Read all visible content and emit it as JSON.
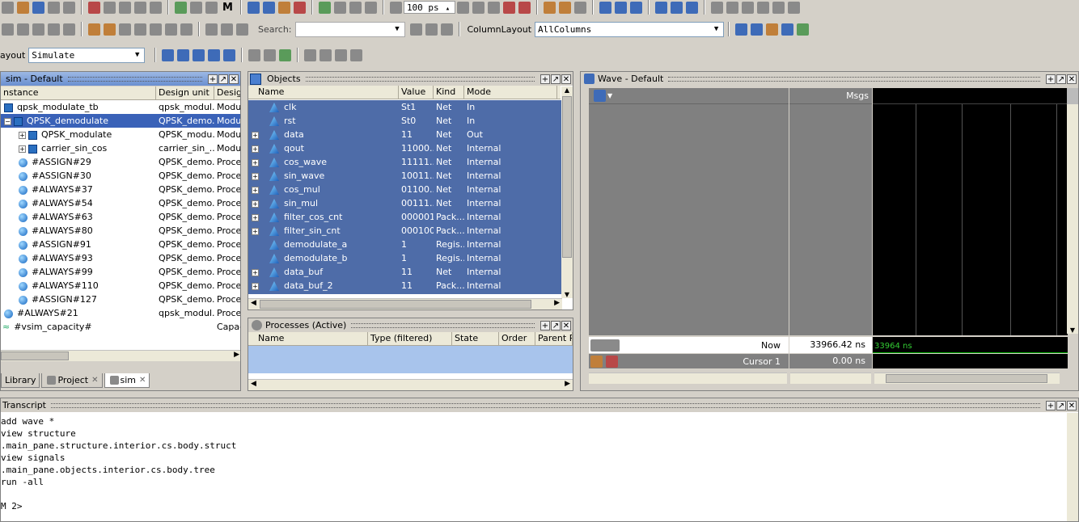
{
  "toolbar1": {
    "zoom_value": "100 ps",
    "m_label": "M"
  },
  "toolbar2": {
    "search_label": "Search:",
    "search_value": "",
    "column_layout_label": "ColumnLayout",
    "column_layout_value": "AllColumns"
  },
  "toolbar3": {
    "layout_label": "ayout",
    "layout_value": "Simulate"
  },
  "sim_panel": {
    "title": "sim - Default",
    "columns": [
      "nstance",
      "Design unit",
      "Design"
    ],
    "rows": [
      {
        "name": "qpsk_modulate_tb",
        "unit": "qpsk_modul...",
        "type": "Module",
        "icon": "module",
        "indent": 0,
        "expander": ""
      },
      {
        "name": "QPSK_demodulate",
        "unit": "QPSK_demo...",
        "type": "Module",
        "icon": "module",
        "indent": 0,
        "expander": "-",
        "selected": true
      },
      {
        "name": "QPSK_modulate",
        "unit": "QPSK_modu...",
        "type": "Module",
        "icon": "module",
        "indent": 1,
        "expander": "+"
      },
      {
        "name": "carrier_sin_cos",
        "unit": "carrier_sin_...",
        "type": "Module",
        "icon": "module",
        "indent": 1,
        "expander": "+"
      },
      {
        "name": "#ASSIGN#29",
        "unit": "QPSK_demo...",
        "type": "Proces",
        "icon": "process",
        "indent": 1,
        "expander": ""
      },
      {
        "name": "#ASSIGN#30",
        "unit": "QPSK_demo...",
        "type": "Proces",
        "icon": "process",
        "indent": 1,
        "expander": ""
      },
      {
        "name": "#ALWAYS#37",
        "unit": "QPSK_demo...",
        "type": "Proces",
        "icon": "process",
        "indent": 1,
        "expander": ""
      },
      {
        "name": "#ALWAYS#54",
        "unit": "QPSK_demo...",
        "type": "Proces",
        "icon": "process",
        "indent": 1,
        "expander": ""
      },
      {
        "name": "#ALWAYS#63",
        "unit": "QPSK_demo...",
        "type": "Proces",
        "icon": "process",
        "indent": 1,
        "expander": ""
      },
      {
        "name": "#ALWAYS#80",
        "unit": "QPSK_demo...",
        "type": "Proces",
        "icon": "process",
        "indent": 1,
        "expander": ""
      },
      {
        "name": "#ASSIGN#91",
        "unit": "QPSK_demo...",
        "type": "Proces",
        "icon": "process",
        "indent": 1,
        "expander": ""
      },
      {
        "name": "#ALWAYS#93",
        "unit": "QPSK_demo...",
        "type": "Proces",
        "icon": "process",
        "indent": 1,
        "expander": ""
      },
      {
        "name": "#ALWAYS#99",
        "unit": "QPSK_demo...",
        "type": "Proces",
        "icon": "process",
        "indent": 1,
        "expander": ""
      },
      {
        "name": "#ALWAYS#110",
        "unit": "QPSK_demo...",
        "type": "Proces",
        "icon": "process",
        "indent": 1,
        "expander": ""
      },
      {
        "name": "#ASSIGN#127",
        "unit": "QPSK_demo...",
        "type": "Proces",
        "icon": "process",
        "indent": 1,
        "expander": ""
      },
      {
        "name": "#ALWAYS#21",
        "unit": "qpsk_modul...",
        "type": "Proces",
        "icon": "process",
        "indent": 0,
        "expander": ""
      },
      {
        "name": "#vsim_capacity#",
        "unit": "",
        "type": "Capac",
        "icon": "capacity",
        "indent": -1,
        "expander": ""
      }
    ],
    "tabs": [
      {
        "label": "Library",
        "active": false
      },
      {
        "label": "Project",
        "active": false
      },
      {
        "label": "sim",
        "active": true
      }
    ]
  },
  "objects_panel": {
    "title": "Objects",
    "columns": [
      "Name",
      "Value",
      "Kind",
      "Mode"
    ],
    "rows": [
      {
        "name": "clk",
        "value": "St1",
        "kind": "Net",
        "mode": "In",
        "expander": ""
      },
      {
        "name": "rst",
        "value": "St0",
        "kind": "Net",
        "mode": "In",
        "expander": ""
      },
      {
        "name": "data",
        "value": "11",
        "kind": "Net",
        "mode": "Out",
        "expander": "+"
      },
      {
        "name": "qout",
        "value": "11000...",
        "kind": "Net",
        "mode": "Internal",
        "expander": "+"
      },
      {
        "name": "cos_wave",
        "value": "11111...",
        "kind": "Net",
        "mode": "Internal",
        "expander": "+"
      },
      {
        "name": "sin_wave",
        "value": "10011...",
        "kind": "Net",
        "mode": "Internal",
        "expander": "+"
      },
      {
        "name": "cos_mul",
        "value": "01100...",
        "kind": "Net",
        "mode": "Internal",
        "expander": "+"
      },
      {
        "name": "sin_mul",
        "value": "00111...",
        "kind": "Net",
        "mode": "Internal",
        "expander": "+"
      },
      {
        "name": "filter_cos_cnt",
        "value": "000001",
        "kind": "Pack...",
        "mode": "Internal",
        "expander": "+"
      },
      {
        "name": "filter_sin_cnt",
        "value": "000100",
        "kind": "Pack...",
        "mode": "Internal",
        "expander": "+"
      },
      {
        "name": "demodulate_a",
        "value": "1",
        "kind": "Regis...",
        "mode": "Internal",
        "expander": ""
      },
      {
        "name": "demodulate_b",
        "value": "1",
        "kind": "Regis...",
        "mode": "Internal",
        "expander": ""
      },
      {
        "name": "data_buf",
        "value": "11",
        "kind": "Net",
        "mode": "Internal",
        "expander": "+"
      },
      {
        "name": "data_buf_2",
        "value": "11",
        "kind": "Pack...",
        "mode": "Internal",
        "expander": "+"
      }
    ]
  },
  "processes_panel": {
    "title": "Processes (Active)",
    "columns": [
      "Name",
      "Type (filtered)",
      "State",
      "Order",
      "Parent Pa"
    ]
  },
  "wave_panel": {
    "title": "Wave - Default",
    "msgs_label": "Msgs",
    "now_label": "Now",
    "now_value": "33966.42 ns",
    "cursor_label": "Cursor 1",
    "cursor_value": "0.00 ns",
    "timeline_label": "33964 ns"
  },
  "transcript": {
    "title": "Transcript",
    "lines": [
      "add wave *",
      "view structure",
      ".main_pane.structure.interior.cs.body.struct",
      "view signals",
      ".main_pane.objects.interior.cs.body.tree",
      "run -all",
      "",
      "M 2>"
    ]
  }
}
